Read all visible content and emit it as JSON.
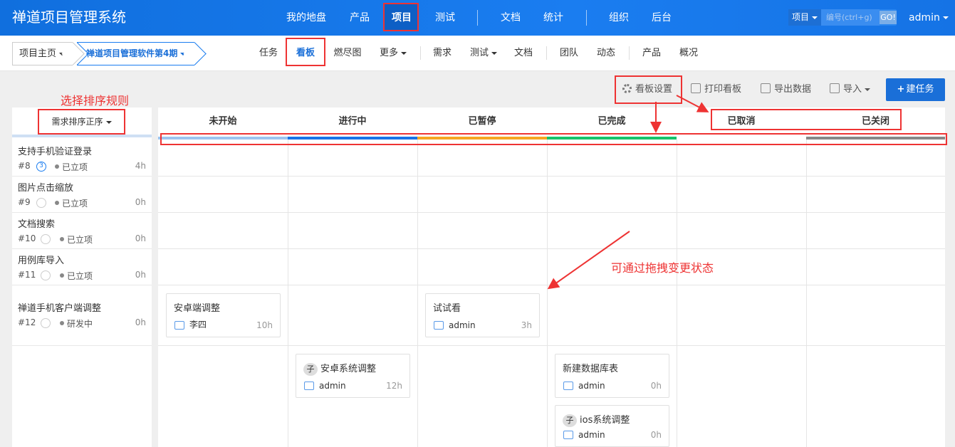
{
  "app": {
    "title": "禅道项目管理系统"
  },
  "nav": {
    "items": [
      "我的地盘",
      "产品",
      "项目",
      "测试",
      "文档",
      "统计",
      "组织",
      "后台"
    ],
    "active": "项目"
  },
  "search": {
    "scope": "项目",
    "placeholder": "编号(ctrl+g)",
    "go": "GO!"
  },
  "user": {
    "name": "admin"
  },
  "breadcrumb": {
    "home": "项目主页",
    "project": "禅道项目管理软件第4期"
  },
  "subnav": {
    "items": [
      "任务",
      "看板",
      "燃尽图",
      "更多",
      "需求",
      "测试",
      "文档",
      "团队",
      "动态",
      "产品",
      "概况"
    ],
    "active": "看板"
  },
  "toolbar": {
    "settings": "看板设置",
    "print": "打印看板",
    "export": "导出数据",
    "import": "导入",
    "create": "建任务"
  },
  "annotations": {
    "sort": "选择排序规则",
    "drag": "可通过拖拽变更状态"
  },
  "sort": {
    "label": "需求排序正序"
  },
  "columns": [
    {
      "name": "未开始",
      "color": "#9ec4f0"
    },
    {
      "name": "进行中",
      "color": "#1a73e8"
    },
    {
      "name": "已暂停",
      "color": "#f6a623"
    },
    {
      "name": "已完成",
      "color": "#18c36a"
    },
    {
      "name": "已取消",
      "color": "#ffffff"
    },
    {
      "name": "已关闭",
      "color": "#888888"
    }
  ],
  "stories": [
    {
      "title": "支持手机验证登录",
      "id": "#8",
      "pri": "3",
      "status": "已立项",
      "estimate": "4h"
    },
    {
      "title": "图片点击缩放",
      "id": "#9",
      "pri": "",
      "status": "已立项",
      "estimate": "0h"
    },
    {
      "title": "文档搜索",
      "id": "#10",
      "pri": "",
      "status": "已立项",
      "estimate": "0h"
    },
    {
      "title": "用例库导入",
      "id": "#11",
      "pri": "",
      "status": "已立项",
      "estimate": "0h"
    },
    {
      "title": "禅道手机客户端调整",
      "id": "#12",
      "pri": "",
      "status": "研发中",
      "estimate": "0h"
    }
  ],
  "cards": [
    {
      "title": "安卓端调整",
      "badge": "",
      "owner": "李四",
      "hours": "10h"
    },
    {
      "title": "试试看",
      "badge": "",
      "owner": "admin",
      "hours": "3h"
    },
    {
      "title": "安卓系统调整",
      "badge": "子",
      "owner": "admin",
      "hours": "12h"
    },
    {
      "title": "新建数据库表",
      "badge": "",
      "owner": "admin",
      "hours": "0h"
    },
    {
      "title": "ios系统调整",
      "badge": "子",
      "owner": "admin",
      "hours": "0h"
    }
  ]
}
